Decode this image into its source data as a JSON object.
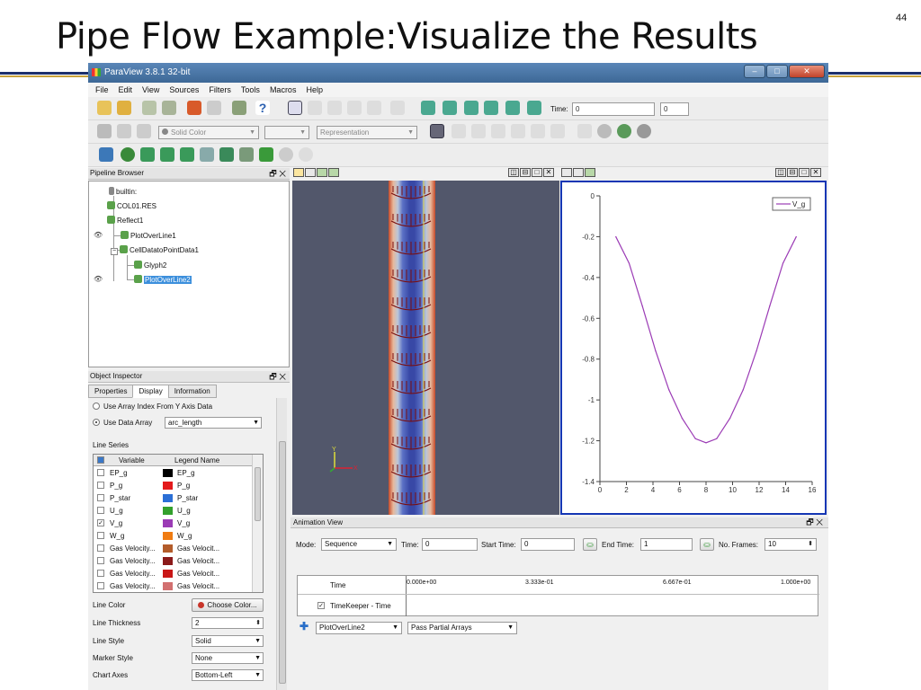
{
  "slide": {
    "title": "Pipe Flow Example:Visualize the Results",
    "page_number": "44"
  },
  "app": {
    "title": "ParaView 3.8.1 32-bit"
  },
  "menu": [
    "File",
    "Edit",
    "View",
    "Sources",
    "Filters",
    "Tools",
    "Macros",
    "Help"
  ],
  "toolbar": {
    "time_label": "Time:",
    "time_value": "0",
    "time_index": "0",
    "color_by": "Solid Color",
    "representation": "Representation"
  },
  "pipeline": {
    "title": "Pipeline Browser",
    "items": [
      {
        "label": "builtin:",
        "selected": false
      },
      {
        "label": "COL01.RES",
        "selected": false
      },
      {
        "label": "Reflect1",
        "selected": false
      },
      {
        "label": "PlotOverLine1",
        "selected": false
      },
      {
        "label": "CellDatatoPointData1",
        "selected": false
      },
      {
        "label": "Glyph2",
        "selected": false
      },
      {
        "label": "PlotOverLine2",
        "selected": true
      }
    ]
  },
  "inspector": {
    "title": "Object Inspector",
    "tabs": [
      "Properties",
      "Display",
      "Information"
    ],
    "active_tab": "Display",
    "x_axis_option1": "Use Array Index From Y Axis Data",
    "x_axis_option2": "Use Data Array",
    "x_array": "arc_length",
    "line_series_label": "Line Series",
    "series_headers": [
      "Variable",
      "Legend Name"
    ],
    "series": [
      {
        "variable": "EP_g",
        "legend": "EP_g",
        "color": "#000000",
        "checked": false
      },
      {
        "variable": "P_g",
        "legend": "P_g",
        "color": "#e31a1c",
        "checked": false
      },
      {
        "variable": "P_star",
        "legend": "P_star",
        "color": "#2b6fd6",
        "checked": false
      },
      {
        "variable": "U_g",
        "legend": "U_g",
        "color": "#33a02c",
        "checked": false
      },
      {
        "variable": "V_g",
        "legend": "V_g",
        "color": "#9b3bb5",
        "checked": true
      },
      {
        "variable": "W_g",
        "legend": "W_g",
        "color": "#f07c12",
        "checked": false
      },
      {
        "variable": "Gas Velocity...",
        "legend": "Gas Velocit...",
        "color": "#b35c2a",
        "checked": false
      },
      {
        "variable": "Gas Velocity...",
        "legend": "Gas Velocit...",
        "color": "#8b1a1a",
        "checked": false
      },
      {
        "variable": "Gas Velocity...",
        "legend": "Gas Velocit...",
        "color": "#c91717",
        "checked": false
      },
      {
        "variable": "Gas Velocity...",
        "legend": "Gas Velocit...",
        "color": "#d27070",
        "checked": false
      }
    ],
    "line_color_label": "Line Color",
    "choose_color": "Choose Color...",
    "line_thickness_label": "Line Thickness",
    "line_thickness": "2",
    "line_style_label": "Line Style",
    "line_style": "Solid",
    "marker_style_label": "Marker Style",
    "marker_style": "None",
    "chart_axes_label": "Chart Axes",
    "chart_axes": "Bottom-Left"
  },
  "chart_data": {
    "type": "line",
    "series": [
      {
        "name": "V_g",
        "color": "#9b3bb5",
        "x": [
          1.2,
          2.2,
          3.2,
          4.2,
          5.2,
          6.2,
          7.2,
          8.0,
          8.8,
          9.8,
          10.8,
          11.8,
          12.8,
          13.8,
          14.8
        ],
        "y": [
          -0.2,
          -0.33,
          -0.54,
          -0.76,
          -0.95,
          -1.09,
          -1.19,
          -1.21,
          -1.19,
          -1.09,
          -0.95,
          -0.76,
          -0.54,
          -0.33,
          -0.2
        ]
      }
    ],
    "xlim": [
      0,
      16
    ],
    "ylim": [
      -1.4,
      0
    ],
    "xticks": [
      "0",
      "2",
      "4",
      "6",
      "8",
      "10",
      "12",
      "14",
      "16"
    ],
    "yticks": [
      "0",
      "-0.2",
      "-0.4",
      "-0.6",
      "-0.8",
      "-1",
      "-1.2",
      "-1.4"
    ],
    "legend": "top-right",
    "grid": false
  },
  "animation": {
    "title": "Animation View",
    "mode_label": "Mode:",
    "mode": "Sequence",
    "time_label": "Time:",
    "time": "0",
    "start_label": "Start Time:",
    "start": "0",
    "end_label": "End Time:",
    "end": "1",
    "frames_label": "No. Frames:",
    "frames": "10",
    "track_header": "Time",
    "timeline_ticks": [
      "0.000e+00",
      "3.333e-01",
      "6.667e-01",
      "1.000e+00"
    ],
    "timekeeper": "TimeKeeper - Time",
    "source": "PlotOverLine2",
    "pass_arrays": "Pass Partial Arrays"
  }
}
